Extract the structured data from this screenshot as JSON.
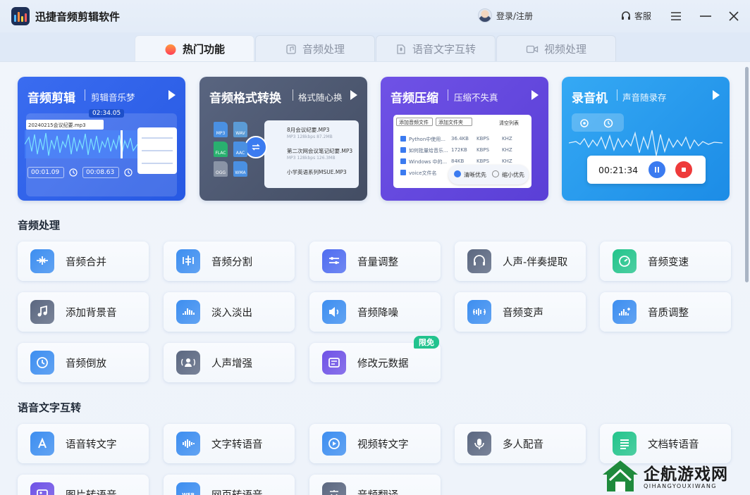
{
  "app": {
    "title": "迅捷音频剪辑软件",
    "login": "登录/注册",
    "service": "客服"
  },
  "tabs": [
    {
      "label": "热门功能",
      "active": true
    },
    {
      "label": "音频处理",
      "active": false
    },
    {
      "label": "语音文字互转",
      "active": false
    },
    {
      "label": "视频处理",
      "active": false
    }
  ],
  "feature_cards": [
    {
      "title": "音频剪辑",
      "subtitle": "剪辑音乐梦",
      "preview": {
        "time_marker": "02:34.05",
        "file_name": "20240215会议纪要.mp3",
        "start_time": "00:01.09",
        "end_time": "00:08.63"
      }
    },
    {
      "title": "音频格式转换",
      "subtitle": "格式随心换",
      "preview": {
        "formats": [
          "MP3",
          "WAV",
          "FLAC",
          "AAC",
          "OGG",
          "WMA"
        ],
        "files": [
          {
            "name": "8月会议纪要.MP3",
            "meta": "MP3   128kbps   87.2MB"
          },
          {
            "name": "第二次网会议笔记纪要.MP3",
            "meta": "MP3   128kbps   126.3MB"
          },
          {
            "name": "小学英语系列MSUE.MP3",
            "meta": ""
          }
        ]
      }
    },
    {
      "title": "音频压缩",
      "subtitle": "压缩不失真",
      "preview": {
        "add_file": "添加音频文件",
        "add_folder": "添加文件夹",
        "clear": "清空列表",
        "rows": [
          {
            "name": "Python中使用...",
            "size": "36.4KB",
            "kbps": "KBPS",
            "khz": "KHZ"
          },
          {
            "name": "如何批量给音乐...",
            "size": "172KB",
            "kbps": "KBPS",
            "khz": "KHZ"
          },
          {
            "name": "Windows 中的...",
            "size": "84KB",
            "kbps": "KBPS",
            "khz": "KHZ"
          },
          {
            "name": "voice文件名",
            "size": "",
            "kbps": "",
            "khz": ""
          }
        ],
        "option_clear": "清晰优先",
        "option_small": "缩小优先"
      }
    },
    {
      "title": "录音机",
      "subtitle": "声音随录存",
      "preview": {
        "time": "00:21:34"
      }
    }
  ],
  "sections": {
    "audio": {
      "title": "音频处理",
      "tools": [
        {
          "label": "音频合并",
          "icon": "merge-icon",
          "color": "#3d8ef0"
        },
        {
          "label": "音频分割",
          "icon": "split-icon",
          "color": "#3d8ef0"
        },
        {
          "label": "音量调整",
          "icon": "volume-adjust-icon",
          "color": "#4f6cf0"
        },
        {
          "label": "人声-伴奏提取",
          "icon": "vocal-extract-icon",
          "color": "#5b6780"
        },
        {
          "label": "音频变速",
          "icon": "speed-icon",
          "color": "#23c48b"
        },
        {
          "label": "添加背景音",
          "icon": "music-note-icon",
          "color": "#5b6780"
        },
        {
          "label": "淡入淡出",
          "icon": "fade-icon",
          "color": "#3d8ef0"
        },
        {
          "label": "音频降噪",
          "icon": "denoise-icon",
          "color": "#3d8ef0"
        },
        {
          "label": "音频变声",
          "icon": "voice-change-icon",
          "color": "#3d8ef0"
        },
        {
          "label": "音质调整",
          "icon": "quality-icon",
          "color": "#3d8ef0"
        },
        {
          "label": "音频倒放",
          "icon": "reverse-icon",
          "color": "#3d8ef0"
        },
        {
          "label": "人声增强",
          "icon": "voice-enhance-icon",
          "color": "#5b6780"
        },
        {
          "label": "修改元数据",
          "icon": "metadata-icon",
          "color": "#6f52e6",
          "badge": "限免"
        }
      ]
    },
    "speech": {
      "title": "语音文字互转",
      "tools": [
        {
          "label": "语音转文字",
          "icon": "speech-to-text-icon",
          "color": "#3d8ef0"
        },
        {
          "label": "文字转语音",
          "icon": "text-to-speech-icon",
          "color": "#3d8ef0"
        },
        {
          "label": "视频转文字",
          "icon": "video-to-text-icon",
          "color": "#3d8ef0"
        },
        {
          "label": "多人配音",
          "icon": "dubbing-icon",
          "color": "#5b6780"
        },
        {
          "label": "文档转语音",
          "icon": "doc-to-speech-icon",
          "color": "#23c48b"
        },
        {
          "label": "图片转语音",
          "icon": "image-to-speech-icon",
          "color": "#6f52e6"
        },
        {
          "label": "网页转语音",
          "icon": "web-to-speech-icon",
          "color": "#3d8ef0"
        },
        {
          "label": "音频翻译",
          "icon": "translate-icon",
          "color": "#5b6780"
        }
      ]
    }
  },
  "watermark": {
    "text": "企航游戏网",
    "sub": "QIHANGYOUXIWANG"
  }
}
